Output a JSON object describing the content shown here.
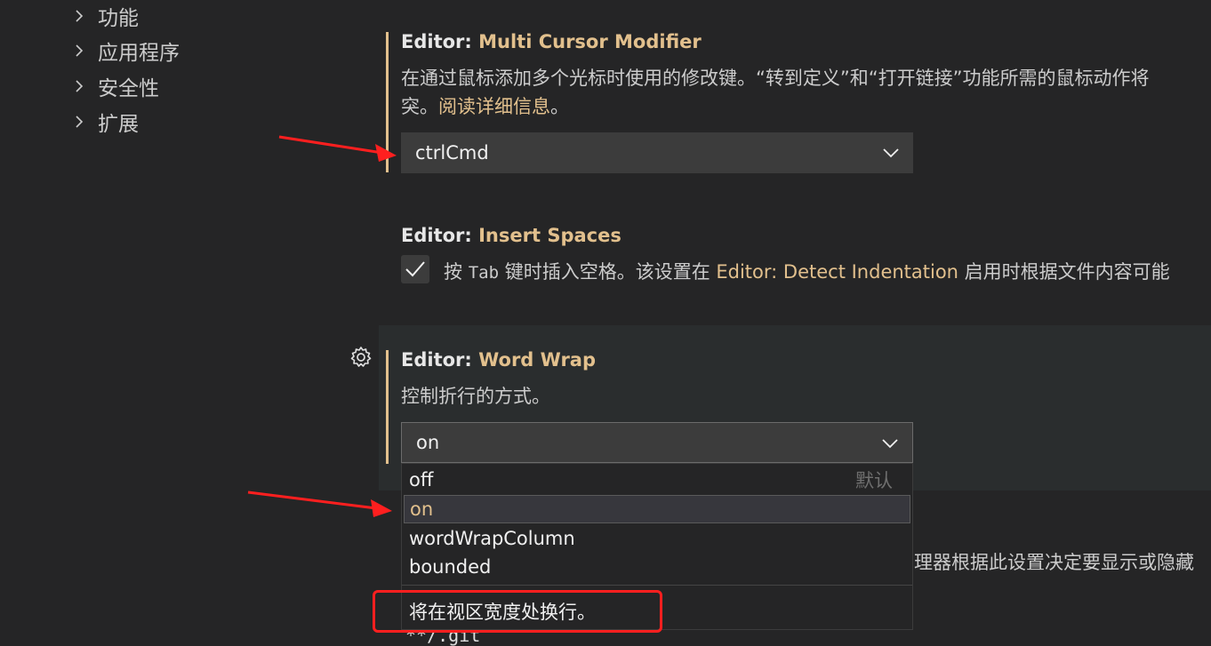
{
  "tree": {
    "items": [
      {
        "label": "功能"
      },
      {
        "label": "应用程序"
      },
      {
        "label": "安全性"
      },
      {
        "label": "扩展"
      }
    ]
  },
  "settings": {
    "multi_cursor": {
      "category": "Editor: ",
      "key": "Multi Cursor Modifier",
      "desc_line1": "在通过鼠标添加多个光标时使用的修改键。“转到定义”和“打开链接”功能所需的鼠标动作将",
      "desc_line2_prefix": "突。",
      "desc_link": "阅读详细信息",
      "desc_line2_suffix": "。",
      "value": "ctrlCmd"
    },
    "insert_spaces": {
      "category": "Editor: ",
      "key": "Insert Spaces",
      "desc_prefix": "按 ",
      "desc_code": "Tab",
      "desc_mid": " 键时插入空格。该设置在 ",
      "desc_link": "Editor: Detect Indentation",
      "desc_suffix": " 启用时根据文件内容可能"
    },
    "word_wrap": {
      "category": "Editor: ",
      "key": "Word Wrap",
      "desc": "控制折行的方式。",
      "value": "on",
      "options": [
        {
          "label": "off",
          "note": "默认"
        },
        {
          "label": "on",
          "note": ""
        },
        {
          "label": "wordWrapColumn",
          "note": ""
        },
        {
          "label": "bounded",
          "note": ""
        }
      ],
      "option_description": "将在视区宽度处换行。"
    }
  },
  "background_fragments": {
    "right_text": "理器根据此设置决定要显示或隐藏",
    "bottom_code": "**/.git"
  },
  "colors": {
    "background": "#252526",
    "accent": "#e2c08d",
    "annotation_red": "#ff1f1f"
  },
  "icons": [
    "chevron-right-icon",
    "chevron-down-icon",
    "checkmark-icon",
    "gear-icon"
  ]
}
